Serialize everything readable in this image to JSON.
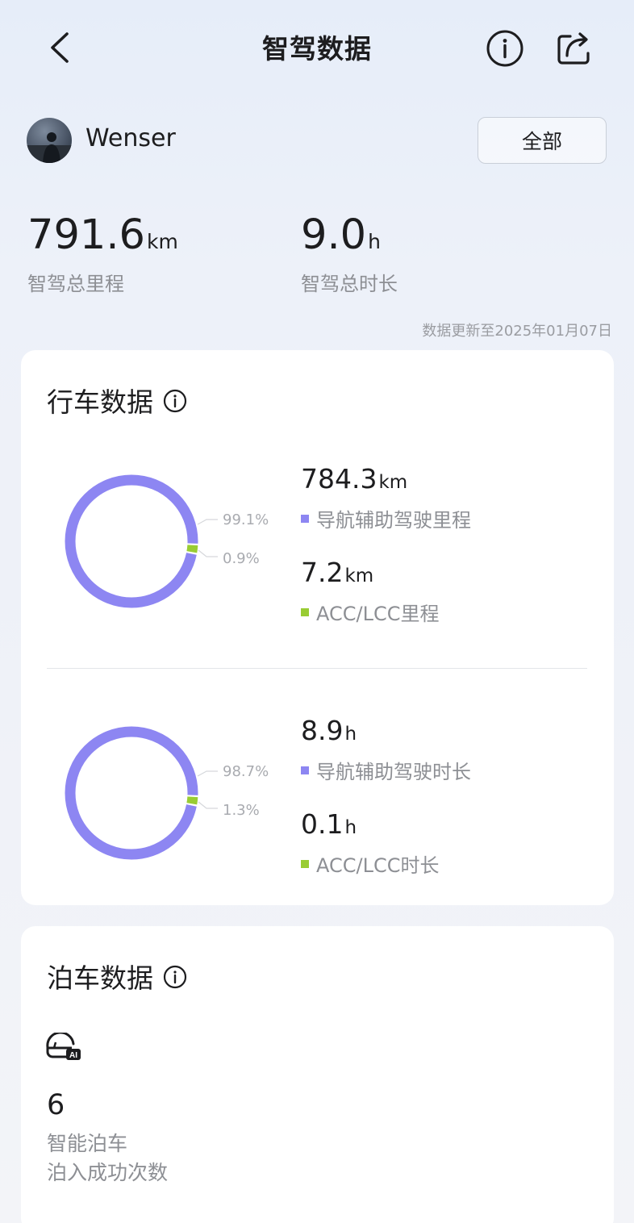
{
  "header": {
    "title": "智驾数据",
    "back_icon": "chevron-left-icon",
    "info_icon": "info-circle-icon",
    "share_icon": "share-icon"
  },
  "user": {
    "name": "Wenser",
    "filter_label": "全部"
  },
  "summary": {
    "total_distance": {
      "value": "791.6",
      "unit": "km",
      "label": "智驾总里程"
    },
    "total_duration": {
      "value": "9.0",
      "unit": "h",
      "label": "智驾总时长"
    },
    "update_note": "数据更新至2025年01月07日"
  },
  "colors": {
    "nav_assist": "#8d86f2",
    "acc_lcc": "#99cc33"
  },
  "driving": {
    "title": "行车数据",
    "distance": {
      "nav_percent_label": "99.1%",
      "acc_percent_label": "0.9%",
      "nav_fraction": 0.991,
      "acc_fraction": 0.009,
      "nav": {
        "value": "784.3",
        "unit": "km",
        "label": "导航辅助驾驶里程"
      },
      "acc": {
        "value": "7.2",
        "unit": "km",
        "label": "ACC/LCC里程"
      }
    },
    "duration": {
      "nav_percent_label": "98.7%",
      "acc_percent_label": "1.3%",
      "nav_fraction": 0.987,
      "acc_fraction": 0.013,
      "nav": {
        "value": "8.9",
        "unit": "h",
        "label": "导航辅助驾驶时长"
      },
      "acc": {
        "value": "0.1",
        "unit": "h",
        "label": "ACC/LCC时长"
      }
    }
  },
  "parking": {
    "title": "泊车数据",
    "icon": "ai-parking-icon",
    "value": "6",
    "label_line1": "智能泊车",
    "label_line2": "泊入成功次数"
  }
}
